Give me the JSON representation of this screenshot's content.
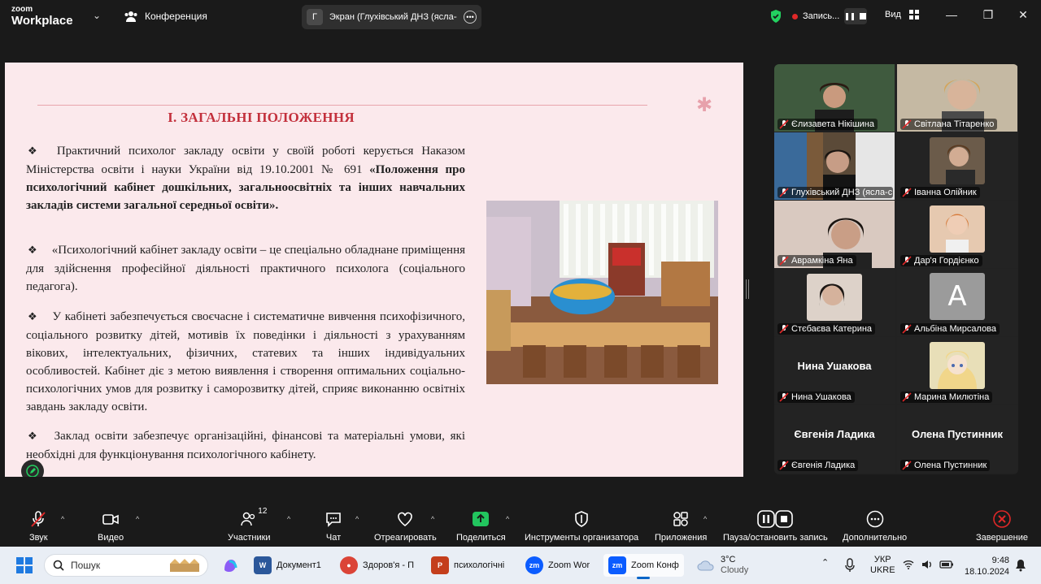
{
  "app": {
    "brand_small": "zoom",
    "brand_big": "Workplace",
    "meeting_title": "Конференция"
  },
  "share": {
    "avatar_letter": "Г",
    "title": "Экран (Глухівський ДНЗ (ясла-садок)"
  },
  "recording": {
    "label": "Запись..."
  },
  "view": {
    "label": "Вид"
  },
  "slide": {
    "title": "І. ЗАГАЛЬНІ ПОЛОЖЕННЯ",
    "bullet": "❖",
    "p1_text": "Практичний психолог закладу освіти у своїй роботі керується Наказом Міністерства освіти і науки України від 19.10.2001 № 691 ",
    "p1_bold": "«Положення про психологічний кабінет дошкільних, загальноосвітніх та інших навчальних закладів системи загальної середньої освіти».",
    "p2": "«Психологічний кабінет закладу освіти – це спеціально обладнане приміщення для здійснення професійної діяльності практичного психолога (соціального педагога).",
    "p3": "У кабінеті забезпечується своєчасне і систематичне вивчення психофізичного, соціального розвитку дітей, мотивів їх поведінки і діяльності з урахуванням вікових, інтелектуальних, фізичних, статевих та інших індивідуальних особливостей. Кабінет діє з метою виявлення і створення оптимальних соціально-психологічних умов для розвитку і саморозвитку дітей, сприяє виконанню освітніх завдань закладу освіти.",
    "p4": "Заклад освіти забезпечує організаційні, фінансові та матеріальні умови, які необхідні для функціонування психологічного кабінету."
  },
  "participants": [
    {
      "name": "Єлизавета Нікішина"
    },
    {
      "name": "Світлана Тітаренко"
    },
    {
      "name": "Глухівський ДНЗ (ясла-с..."
    },
    {
      "name": "Іванна Олійник"
    },
    {
      "name": "Аврамкіна Яна"
    },
    {
      "name": "Дар'я Гордієнко"
    },
    {
      "name": "Стєбаєва Катерина"
    },
    {
      "name": "Альбіна Мирсалова",
      "avatar_letter": "A"
    },
    {
      "name": "Нина Ушакова",
      "big_name": "Нина Ушакова"
    },
    {
      "name": "Марина Милютіна"
    },
    {
      "name": "Євгенія Ладика",
      "big_name": "Євгенія Ладика"
    },
    {
      "name": "Олена Пустинник",
      "big_name": "Олена Пустинник"
    }
  ],
  "toolbar": {
    "mute": "Звук",
    "video": "Видео",
    "participants": "Участники",
    "participants_count": "12",
    "chat": "Чат",
    "react": "Отреагировать",
    "share": "Поделиться",
    "host_tools": "Инструменты организатора",
    "apps": "Приложения",
    "pause_rec": "Пауза/остановить запись",
    "more": "Дополнительно",
    "end": "Завершение"
  },
  "taskbar": {
    "search_placeholder": "Пошук",
    "apps": [
      {
        "label": "Документ1"
      },
      {
        "label": "Здоров'я - П"
      },
      {
        "label": "психологічні"
      },
      {
        "label": "Zoom Wor"
      },
      {
        "label": "Zoom Конф"
      }
    ],
    "weather_temp": "3°C",
    "weather_desc": "Cloudy",
    "lang_1": "УКР",
    "lang_2": "UKRE",
    "time": "9:48",
    "date": "18.10.2024"
  },
  "colors": {
    "accent_green": "#23d160",
    "share_green": "#22c55e",
    "end_red": "#e02828",
    "slide_title": "#c3303c"
  }
}
